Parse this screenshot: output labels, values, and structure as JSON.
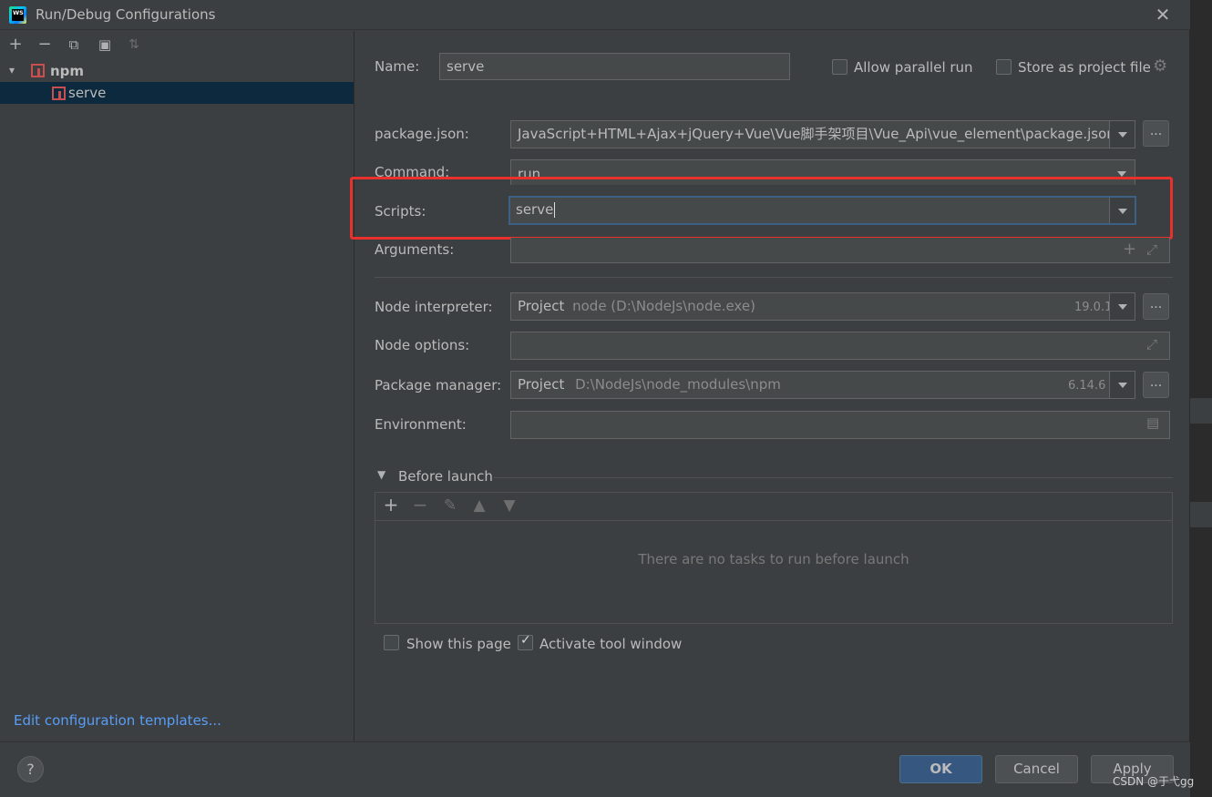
{
  "window": {
    "title": "Run/Debug Configurations",
    "app_logo_text": "WS"
  },
  "tree": {
    "root_label": "npm",
    "child_label": "serve"
  },
  "left_footer": {
    "edit_templates_link": "Edit configuration templates..."
  },
  "form": {
    "name_label": "Name:",
    "name_value": "serve",
    "allow_parallel_label": "Allow parallel run",
    "allow_parallel_checked": false,
    "store_project_label": "Store as project file",
    "store_project_checked": false,
    "package_json_label": "package.json:",
    "package_json_value": "JavaScript+HTML+Ajax+jQuery+Vue\\Vue脚手架项目\\Vue_Api\\vue_element\\package.json",
    "command_label": "Command:",
    "command_value": "run",
    "scripts_label": "Scripts:",
    "scripts_value": "serve",
    "arguments_label": "Arguments:",
    "arguments_value": "",
    "node_interpreter_label": "Node interpreter:",
    "node_interpreter_value": "Project",
    "node_interpreter_path": "node (D:\\NodeJs\\node.exe)",
    "node_interpreter_version": "19.0.1",
    "node_options_label": "Node options:",
    "node_options_value": "",
    "package_manager_label": "Package manager:",
    "package_manager_value": "Project",
    "package_manager_path": "D:\\NodeJs\\node_modules\\npm",
    "package_manager_version": "6.14.6",
    "environment_label": "Environment:",
    "environment_value": "",
    "browse_label": "..."
  },
  "before_launch": {
    "header": "Before launch",
    "empty_text": "There are no tasks to run before launch"
  },
  "options": {
    "show_page_label": "Show this page",
    "show_page_checked": false,
    "activate_tool_label": "Activate tool window",
    "activate_tool_checked": true
  },
  "buttons": {
    "help": "?",
    "ok": "OK",
    "cancel": "Cancel",
    "apply": "Apply"
  },
  "watermark": "CSDN @于弋gg",
  "colors": {
    "dialog_bg": "#3c3f41",
    "selection_bg": "#0d293e",
    "link": "#589df6",
    "highlight_box": "#e8302c",
    "ok_button": "#365880"
  }
}
